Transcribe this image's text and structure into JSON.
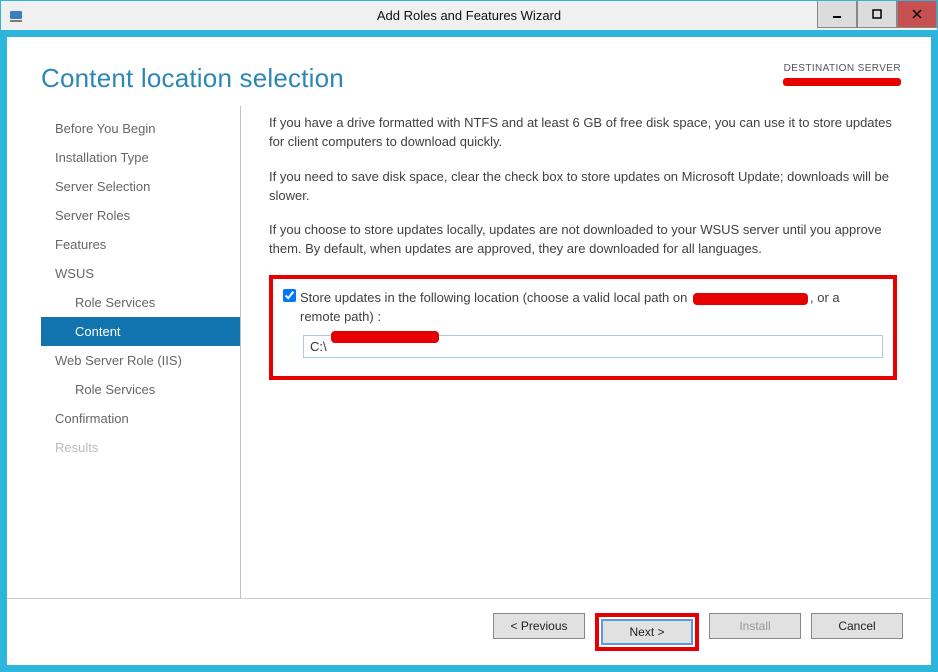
{
  "window": {
    "title": "Add Roles and Features Wizard"
  },
  "header": {
    "page_title": "Content location selection",
    "destination_label": "DESTINATION SERVER"
  },
  "sidebar": {
    "items": [
      {
        "label": "Before You Begin",
        "sub": false,
        "selected": false,
        "disabled": false
      },
      {
        "label": "Installation Type",
        "sub": false,
        "selected": false,
        "disabled": false
      },
      {
        "label": "Server Selection",
        "sub": false,
        "selected": false,
        "disabled": false
      },
      {
        "label": "Server Roles",
        "sub": false,
        "selected": false,
        "disabled": false
      },
      {
        "label": "Features",
        "sub": false,
        "selected": false,
        "disabled": false
      },
      {
        "label": "WSUS",
        "sub": false,
        "selected": false,
        "disabled": false
      },
      {
        "label": "Role Services",
        "sub": true,
        "selected": false,
        "disabled": false
      },
      {
        "label": "Content",
        "sub": true,
        "selected": true,
        "disabled": false
      },
      {
        "label": "Web Server Role (IIS)",
        "sub": false,
        "selected": false,
        "disabled": false
      },
      {
        "label": "Role Services",
        "sub": true,
        "selected": false,
        "disabled": false
      },
      {
        "label": "Confirmation",
        "sub": false,
        "selected": false,
        "disabled": false
      },
      {
        "label": "Results",
        "sub": false,
        "selected": false,
        "disabled": true
      }
    ]
  },
  "content": {
    "para1": "If you have a drive formatted with NTFS and at least 6 GB of free disk space, you can use it to store updates for client computers to download quickly.",
    "para2": "If you need to save disk space, clear the check box to store updates on Microsoft Update; downloads will be slower.",
    "para3": "If you choose to store updates locally, updates are not downloaded to your WSUS server until you approve them. By default, when updates are approved, they are downloaded for all languages.",
    "checkbox_checked": true,
    "checkbox_label_a": "Store updates in the following location (choose a valid local path on ",
    "checkbox_label_b": ", or a remote path) :",
    "path_value": "C:\\"
  },
  "buttons": {
    "previous": "< Previous",
    "next": "Next >",
    "install": "Install",
    "cancel": "Cancel"
  }
}
